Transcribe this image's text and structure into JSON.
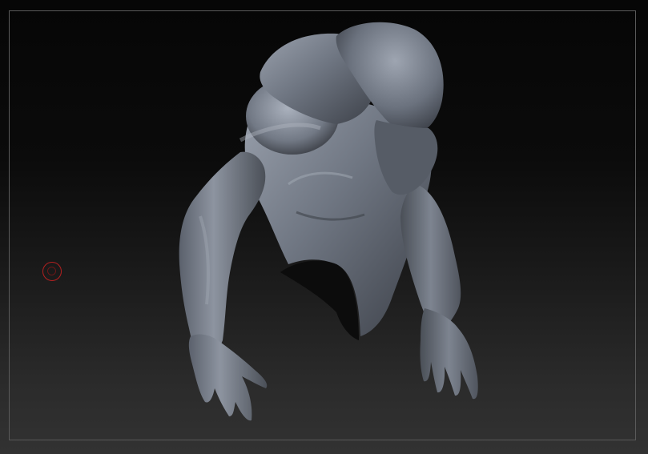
{
  "viewport": {
    "background_top": "#060606",
    "background_bottom": "#323232",
    "frame_color": "#5a5a5a"
  },
  "model": {
    "kind": "sculpted-creature-torso-and-arms",
    "material_color": "#6d7380"
  },
  "cursor": {
    "icon": "brush-cursor-icon",
    "color": "#b42020"
  }
}
